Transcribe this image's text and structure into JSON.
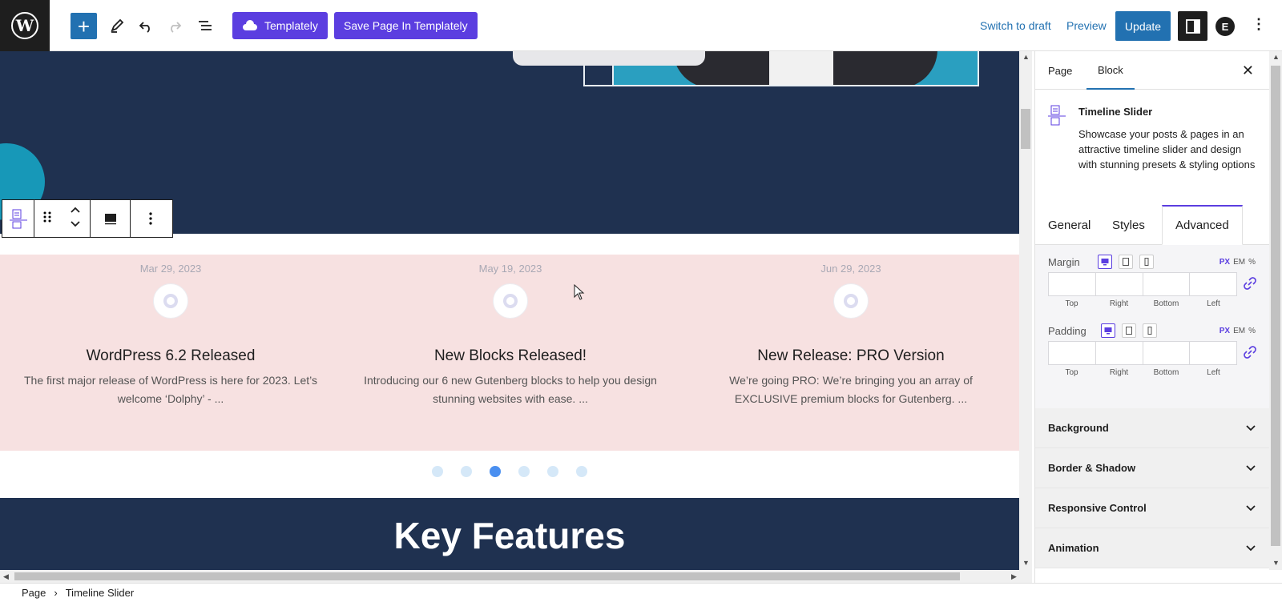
{
  "topbar": {
    "templately_label": "Templately",
    "save_templately_label": "Save Page In Templately",
    "switch_draft": "Switch to draft",
    "preview": "Preview",
    "update": "Update",
    "add_symbol": "+",
    "more_symbol": "⋮",
    "ea_symbol": "E"
  },
  "canvas": {
    "timeline": [
      {
        "date": "Mar 29, 2023",
        "title": "WordPress 6.2 Released",
        "text": "The first major release of WordPress is here for 2023. Let’s welcome ‘Dolphy’ - ..."
      },
      {
        "date": "May 19, 2023",
        "title": "New Blocks Released!",
        "text": "Introducing our 6 new Gutenberg blocks to help you design stunning websites with ease. ..."
      },
      {
        "date": "Jun 29, 2023",
        "title": "New Release: PRO Version",
        "text": "We’re going PRO: We’re bringing you an array of EXCLUSIVE premium blocks for Gutenberg. ..."
      }
    ],
    "slider": {
      "total_dots": 6,
      "active_index": 2
    },
    "features_heading": "Key Features"
  },
  "sidebar": {
    "tabs": [
      "Page",
      "Block"
    ],
    "active_tab": "Block",
    "close_symbol": "✕",
    "block": {
      "title": "Timeline Slider",
      "description": "Showcase your posts & pages in an attractive timeline slider and design with stunning presets & styling options"
    },
    "inner_tabs": [
      "General",
      "Styles",
      "Advanced"
    ],
    "active_inner_tab": "Advanced",
    "margin": {
      "label": "Margin",
      "units": [
        "PX",
        "EM",
        "%"
      ],
      "sides": [
        "Top",
        "Right",
        "Bottom",
        "Left"
      ]
    },
    "padding": {
      "label": "Padding",
      "units": [
        "PX",
        "EM",
        "%"
      ],
      "sides": [
        "Top",
        "Right",
        "Bottom",
        "Left"
      ]
    },
    "panels": [
      "Background",
      "Border & Shadow",
      "Responsive Control",
      "Animation"
    ]
  },
  "footer": {
    "breadcrumb": [
      "Page",
      "Timeline Slider"
    ],
    "separator": "›"
  },
  "colors": {
    "accent": "#2271b1",
    "templately_purple": "#5b3ee0",
    "hero_navy": "#1f3150",
    "timeline_bg": "#f7e1e1",
    "active_dot": "#4a8ff0"
  }
}
